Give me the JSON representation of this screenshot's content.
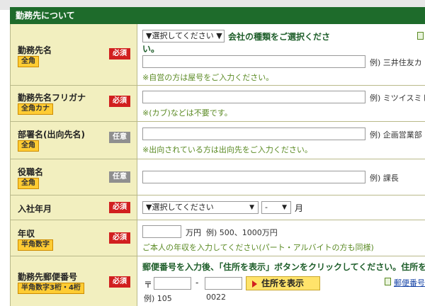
{
  "section": {
    "title": "勤務先について"
  },
  "rows": {
    "employer": {
      "label": "勤務先名",
      "tag": "全角",
      "badge": "必須",
      "company_type_select": "▼選択してください ▼",
      "instruction_line1": "会社の種類をご選択くださ",
      "instruction_line2": "い。",
      "input_value": "",
      "example": "例) 三井住友カ",
      "note": "※自営の方は屋号をご入力ください。",
      "doc_icon": "document-icon"
    },
    "employer_kana": {
      "label": "勤務先名フリガナ",
      "tag": "全角カナ",
      "badge": "必須",
      "input_value": "",
      "example": "例) ミツイスミトモ",
      "note": "※(カブ)などは不要です。"
    },
    "department": {
      "label": "部署名(出向先名)",
      "tag": "全角",
      "badge": "任意",
      "input_value": "",
      "example": "例) 企画営業部",
      "note": "※出向されている方は出向先をご入力ください。"
    },
    "position": {
      "label": "役職名",
      "tag": "全角",
      "badge": "任意",
      "input_value": "",
      "example": "例) 課長"
    },
    "join_date": {
      "label": "入社年月",
      "badge": "必須",
      "year_select": "▼選択してください",
      "month_select": "-",
      "month_unit": "月"
    },
    "income": {
      "label": "年収",
      "tag": "半角数字",
      "badge": "必須",
      "input_value": "",
      "unit": "万円",
      "example": "例) 500、1000万円",
      "note": "ご本人の年収を入力してください(パート・アルバイトの方も同様)"
    },
    "postal": {
      "label": "勤務先郵便番号",
      "tag": "半角数字3桁・4桁",
      "badge": "必須",
      "instruction": "郵便番号を入力後、「住所を表示」ボタンをクリックしてください。住所を",
      "postal_mark": "〒",
      "dash": "-",
      "zip1_value": "",
      "zip2_value": "",
      "button_label": "住所を表示",
      "example_zip1": "例) 105",
      "example_zip2": "0022",
      "link_label": "郵便番号"
    }
  }
}
